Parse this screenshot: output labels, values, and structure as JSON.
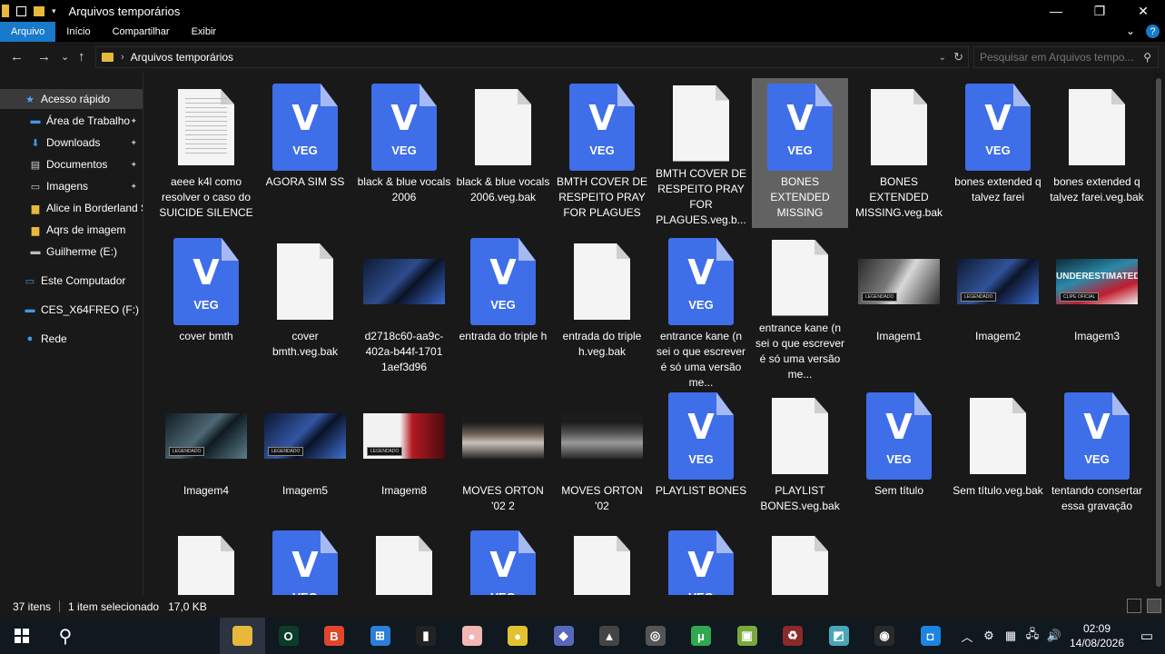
{
  "window": {
    "title": "Arquivos temporários",
    "controls": {
      "minimize": "—",
      "restore": "❐",
      "close": "✕"
    }
  },
  "ribbon": {
    "tabs": [
      "Arquivo",
      "Início",
      "Compartilhar",
      "Exibir"
    ],
    "active_tab": "Arquivo",
    "right": {
      "expand": "⌄",
      "help": "?"
    }
  },
  "address": {
    "back": "←",
    "forward": "→",
    "history": "⌄",
    "up": "↑",
    "separator": "›",
    "path": "Arquivos temporários",
    "dropdown": "⌄",
    "refresh": "↻",
    "search_placeholder": "Pesquisar em Arquivos tempo...",
    "search_icon": "⚲"
  },
  "sidebar": {
    "items": [
      {
        "label": "Acesso rápido",
        "icon": "star-icon",
        "glyph": "★",
        "color": "#4aa3ff",
        "pinned": false,
        "selected": true
      },
      {
        "label": "Área de Trabalho",
        "icon": "desktop-icon",
        "glyph": "▬",
        "color": "#3d9be9",
        "pinned": true
      },
      {
        "label": "Downloads",
        "icon": "download-icon",
        "glyph": "⬇",
        "color": "#3d9be9",
        "pinned": true
      },
      {
        "label": "Documentos",
        "icon": "documents-icon",
        "glyph": "▤",
        "color": "#cfcfcf",
        "pinned": true
      },
      {
        "label": "Imagens",
        "icon": "images-icon",
        "glyph": "▭",
        "color": "#cfcfcf",
        "pinned": true
      },
      {
        "label": "Alice in Borderland S",
        "icon": "folder-icon",
        "glyph": "▆",
        "color": "#e8b83c",
        "pinned": false
      },
      {
        "label": "Aqrs de imagem",
        "icon": "folder-icon",
        "glyph": "▆",
        "color": "#e8b83c",
        "pinned": false
      },
      {
        "label": "Guilherme (E:)",
        "icon": "drive-icon",
        "glyph": "▬",
        "color": "#bdbdbd",
        "pinned": false
      },
      {
        "label": "Este Computador",
        "icon": "computer-icon",
        "glyph": "▭",
        "color": "#3d9be9",
        "pinned": false
      },
      {
        "label": "CES_X64FREO (F:)",
        "icon": "disc-drive-icon",
        "glyph": "▬",
        "color": "#3d9be9",
        "pinned": false
      },
      {
        "label": "Rede",
        "icon": "network-icon",
        "glyph": "●",
        "color": "#3d9be9",
        "pinned": false
      }
    ],
    "pin_glyph": "📌"
  },
  "files": [
    {
      "name": "aeee k4l como resolver o caso do SUICIDE SILENCE",
      "kind": "txt"
    },
    {
      "name": "AGORA SIM SS",
      "kind": "veg"
    },
    {
      "name": "black & blue vocals 2006",
      "kind": "veg"
    },
    {
      "name": "black & blue vocals 2006.veg.bak",
      "kind": "doc"
    },
    {
      "name": "BMTH COVER DE RESPEITO PRAY FOR PLAGUES",
      "kind": "veg"
    },
    {
      "name": "BMTH COVER DE RESPEITO PRAY FOR PLAGUES.veg.b...",
      "kind": "doc"
    },
    {
      "name": "BONES EXTENDED MISSING",
      "kind": "veg",
      "selected": true
    },
    {
      "name": "BONES EXTENDED MISSING.veg.bak",
      "kind": "doc"
    },
    {
      "name": "bones extended q talvez farei",
      "kind": "veg"
    },
    {
      "name": "bones extended q talvez farei.veg.bak",
      "kind": "doc"
    },
    {
      "name": "cover bmth",
      "kind": "veg"
    },
    {
      "name": "cover bmth.veg.bak",
      "kind": "doc"
    },
    {
      "name": "d2718c60-aa9c-402a-b44f-1701 1aef3d96",
      "kind": "img",
      "bg": "linear-gradient(135deg,#0e1a33,#2d4c8c 45%,#0b1224 60%,#3a6ad0)",
      "tag": ""
    },
    {
      "name": "entrada do triple h",
      "kind": "veg"
    },
    {
      "name": "entrada do triple h.veg.bak",
      "kind": "doc"
    },
    {
      "name": "entrance kane (n sei o que escrever é só uma versão me...",
      "kind": "veg"
    },
    {
      "name": "entrance kane (n sei o que escrever é só uma versão me...",
      "kind": "doc"
    },
    {
      "name": "Imagem1",
      "kind": "img",
      "bg": "linear-gradient(120deg,#2a2a2a,#7a7a7a 40%,#d8d8d8 55%,#2e2e2e)",
      "tag": "LEGENDADO"
    },
    {
      "name": "Imagem2",
      "kind": "img",
      "bg": "linear-gradient(135deg,#0d1830,#31539a 45%,#0c1428 60%,#3a6ad0)",
      "tag": "LEGENDADO"
    },
    {
      "name": "Imagem3",
      "kind": "img",
      "bg": "linear-gradient(160deg,#0f2a3c,#2a8aa8 40%,#c01c2e 70%,#efefef)",
      "tag": "CLIPE OFICIAL",
      "title": "UNDERESTIMATED"
    },
    {
      "name": "Imagem4",
      "kind": "img",
      "bg": "linear-gradient(135deg,#101c22,#4d6874 45%,#0f1a20 60%,#5c7d8a)",
      "tag": "LEGENDADO"
    },
    {
      "name": "Imagem5",
      "kind": "img",
      "bg": "linear-gradient(135deg,#0b1630,#3356a3 45%,#0a1226 60%,#4071d4)",
      "tag": "LEGENDADO"
    },
    {
      "name": "Imagem8",
      "kind": "img",
      "bg": "linear-gradient(90deg,#f2f2f2 45%,#b31a22 60%,#4b0a0e)",
      "tag": "LEGENDADO"
    },
    {
      "name": "MOVES ORTON '02 2",
      "kind": "img",
      "bg": "linear-gradient(180deg,#1a1a1a 20%,#6a5d52 45%,#c9c1b9 65%,#262626)",
      "tag": ""
    },
    {
      "name": "MOVES ORTON '02",
      "kind": "img",
      "bg": "linear-gradient(180deg,#1c1c1c 20%,#555 45%,#9a9a9a 65%,#262626)",
      "tag": ""
    },
    {
      "name": "PLAYLIST BONES",
      "kind": "veg"
    },
    {
      "name": "PLAYLIST BONES.veg.bak",
      "kind": "doc"
    },
    {
      "name": "Sem título",
      "kind": "veg"
    },
    {
      "name": "Sem título.veg.bak",
      "kind": "doc"
    },
    {
      "name": "tentando consertar essa gravação",
      "kind": "veg"
    },
    {
      "name": "",
      "kind": "doc"
    },
    {
      "name": "",
      "kind": "veg"
    },
    {
      "name": "",
      "kind": "doc"
    },
    {
      "name": "",
      "kind": "veg"
    },
    {
      "name": "",
      "kind": "doc"
    },
    {
      "name": "",
      "kind": "veg"
    },
    {
      "name": "",
      "kind": "doc"
    }
  ],
  "veg_icon": {
    "letter": "V",
    "text": "VEG"
  },
  "status": {
    "count": "37 itens",
    "selection": "1 item selecionado",
    "size": "17,0 KB"
  },
  "taskbar": {
    "search_glyph": "⚲",
    "apps": [
      {
        "name": "file-explorer",
        "color": "#e8b83c",
        "glyph": "",
        "active": true
      },
      {
        "name": "opera-gx",
        "color": "#0d3b2a",
        "glyph": "O"
      },
      {
        "name": "brave",
        "color": "#e0462b",
        "glyph": "B"
      },
      {
        "name": "microsoft-store",
        "color": "#2b7fd6",
        "glyph": "⊞"
      },
      {
        "name": "audio-app",
        "color": "#222",
        "glyph": "▮"
      },
      {
        "name": "pig-app",
        "color": "#f2b7b4",
        "glyph": "●"
      },
      {
        "name": "bee-app",
        "color": "#e2c231",
        "glyph": "●"
      },
      {
        "name": "vegas-app",
        "color": "#5768b8",
        "glyph": "◆"
      },
      {
        "name": "fox-app",
        "color": "#444",
        "glyph": "▲"
      },
      {
        "name": "gamepad-app",
        "color": "#555",
        "glyph": "◎"
      },
      {
        "name": "utorrent",
        "color": "#2fa84f",
        "glyph": "μ"
      },
      {
        "name": "installer-app",
        "color": "#7aa93b",
        "glyph": "▣"
      },
      {
        "name": "recycle-app",
        "color": "#8a2a2a",
        "glyph": "♻"
      },
      {
        "name": "editor-app",
        "color": "#49a7b8",
        "glyph": "◩"
      },
      {
        "name": "obs-studio",
        "color": "#2a2a2a",
        "glyph": "◉"
      },
      {
        "name": "blue-app",
        "color": "#1d84e0",
        "glyph": "◘"
      }
    ],
    "tray": {
      "chevron": "︿",
      "icons": [
        "⚙",
        "▦",
        "🖧",
        "🔊"
      ]
    },
    "time": "02:09",
    "date": "14/08/2026",
    "notification_glyph": "▭"
  }
}
